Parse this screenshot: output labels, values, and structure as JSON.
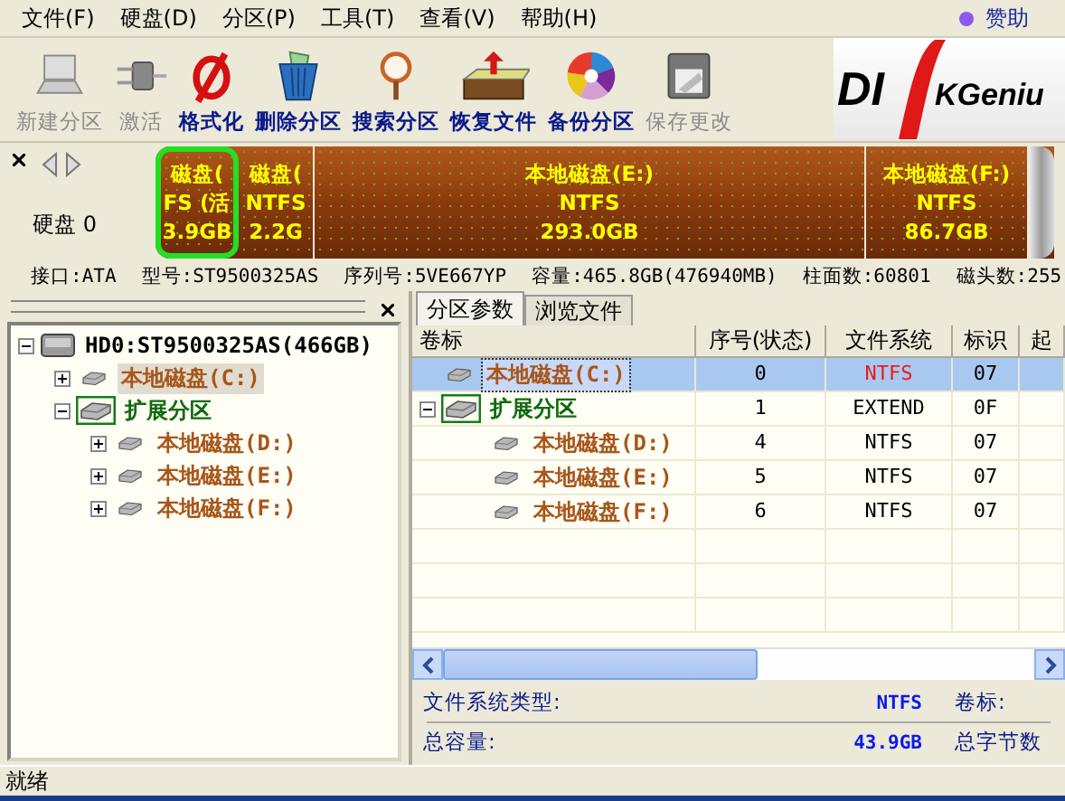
{
  "menu": [
    {
      "label": "文件(F)"
    },
    {
      "label": "硬盘(D)"
    },
    {
      "label": "分区(P)"
    },
    {
      "label": "工具(T)"
    },
    {
      "label": "查看(V)"
    },
    {
      "label": "帮助(H)"
    }
  ],
  "sponsor": {
    "label": "赞助"
  },
  "toolbar": [
    {
      "label": "新建分区",
      "disabled": true
    },
    {
      "label": "激活",
      "disabled": true
    },
    {
      "label": "格式化",
      "disabled": false
    },
    {
      "label": "删除分区",
      "disabled": false
    },
    {
      "label": "搜索分区",
      "disabled": false
    },
    {
      "label": "恢复文件",
      "disabled": false
    },
    {
      "label": "备份分区",
      "disabled": false
    },
    {
      "label": "保存更改",
      "disabled": true
    }
  ],
  "logo": {
    "parts": [
      "DI",
      "KGeniu"
    ]
  },
  "disk_map": {
    "label": "硬盘 0",
    "partitions": [
      {
        "lines": [
          "磁盘(",
          "FS (活",
          "3.9GB"
        ],
        "selected": true
      },
      {
        "lines": [
          "磁盘(",
          "NTFS",
          "2.2G"
        ],
        "selected": false
      },
      {
        "lines": [
          "本地磁盘(E:)",
          "NTFS",
          "293.0GB"
        ],
        "selected": false
      },
      {
        "lines": [
          "本地磁盘(F:)",
          "NTFS",
          "86.7GB"
        ],
        "selected": false
      }
    ]
  },
  "disk_info": [
    "接口:ATA",
    "型号:ST9500325AS",
    "序列号:5VE667YP",
    "容量:465.8GB(476940MB)",
    "柱面数:60801",
    "磁头数:255"
  ],
  "tree": {
    "label": "HD0:ST9500325AS(466GB)",
    "kind": "disk",
    "selected": false,
    "expanded": true,
    "children": [
      {
        "label": "本地磁盘(C:)",
        "kind": "partition",
        "selected": true,
        "expanded": false
      },
      {
        "label": "扩展分区",
        "kind": "extended",
        "selected": false,
        "expanded": true,
        "children": [
          {
            "label": "本地磁盘(D:)",
            "kind": "partition",
            "selected": false,
            "expanded": false
          },
          {
            "label": "本地磁盘(E:)",
            "kind": "partition",
            "selected": false,
            "expanded": false
          },
          {
            "label": "本地磁盘(F:)",
            "kind": "partition",
            "selected": false,
            "expanded": false
          }
        ]
      }
    ]
  },
  "tabs": [
    {
      "label": "分区参数",
      "selected": true
    },
    {
      "label": "浏览文件",
      "selected": false
    }
  ],
  "table": {
    "columns": [
      "卷标",
      "序号(状态)",
      "文件系统",
      "标识",
      "起"
    ],
    "rows": [
      {
        "kind": "partition",
        "selected": true,
        "active": true,
        "cells": [
          "本地磁盘(C:)",
          "0",
          "NTFS",
          "07"
        ]
      },
      {
        "kind": "extended",
        "selected": false,
        "active": false,
        "expanded": true,
        "cells": [
          "扩展分区",
          "1",
          "EXTEND",
          "0F"
        ],
        "children": [
          {
            "kind": "partition",
            "selected": false,
            "active": false,
            "cells": [
              "本地磁盘(D:)",
              "4",
              "NTFS",
              "07"
            ]
          },
          {
            "kind": "partition",
            "selected": false,
            "active": false,
            "cells": [
              "本地磁盘(E:)",
              "5",
              "NTFS",
              "07"
            ]
          },
          {
            "kind": "partition",
            "selected": false,
            "active": false,
            "cells": [
              "本地磁盘(F:)",
              "6",
              "NTFS",
              "07"
            ]
          }
        ]
      }
    ]
  },
  "details": [
    {
      "label": "文件系统类型:",
      "value": "NTFS",
      "label2": "卷标:"
    },
    {
      "label": "总容量:",
      "value": "43.9GB",
      "label2": "总字节数"
    }
  ],
  "status_bar": "就绪"
}
